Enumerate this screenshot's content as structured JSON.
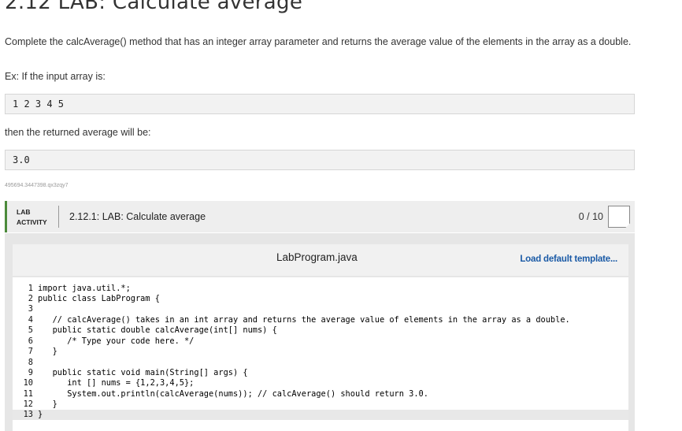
{
  "header": {
    "title": "2.12 LAB: Calculate average"
  },
  "instructions": {
    "description": "Complete the calcAverage() method that has an integer array parameter and returns the average value of the elements in the array as a double.",
    "example_label": "Ex: If the input array is:",
    "input_example": "1 2 3 4 5",
    "then_label": "then the returned average will be:",
    "output_example": "3.0",
    "tracking_id": "495694.3447398.qx3zqy7"
  },
  "activity": {
    "type_line1": "LAB",
    "type_line2": "ACTIVITY",
    "title": "2.12.1: LAB: Calculate average",
    "score": "0 / 10"
  },
  "editor": {
    "file_name": "LabProgram.java",
    "load_template_label": "Load default template...",
    "lines": [
      {
        "n": "1",
        "text": "import java.util.*;"
      },
      {
        "n": "2",
        "text": "public class LabProgram {"
      },
      {
        "n": "3",
        "text": ""
      },
      {
        "n": "4",
        "text": "   // calcAverage() takes in an int array and returns the average value of elements in the array as a double."
      },
      {
        "n": "5",
        "text": "   public static double calcAverage(int[] nums) {"
      },
      {
        "n": "6",
        "text": "      /* Type your code here. */"
      },
      {
        "n": "7",
        "text": "   }"
      },
      {
        "n": "8",
        "text": ""
      },
      {
        "n": "9",
        "text": "   public static void main(String[] args) {"
      },
      {
        "n": "10",
        "text": "      int [] nums = {1,2,3,4,5};"
      },
      {
        "n": "11",
        "text": "      System.out.println(calcAverage(nums)); // calcAverage() should return 3.0."
      },
      {
        "n": "12",
        "text": "   }"
      },
      {
        "n": "13",
        "text": "}"
      }
    ]
  }
}
